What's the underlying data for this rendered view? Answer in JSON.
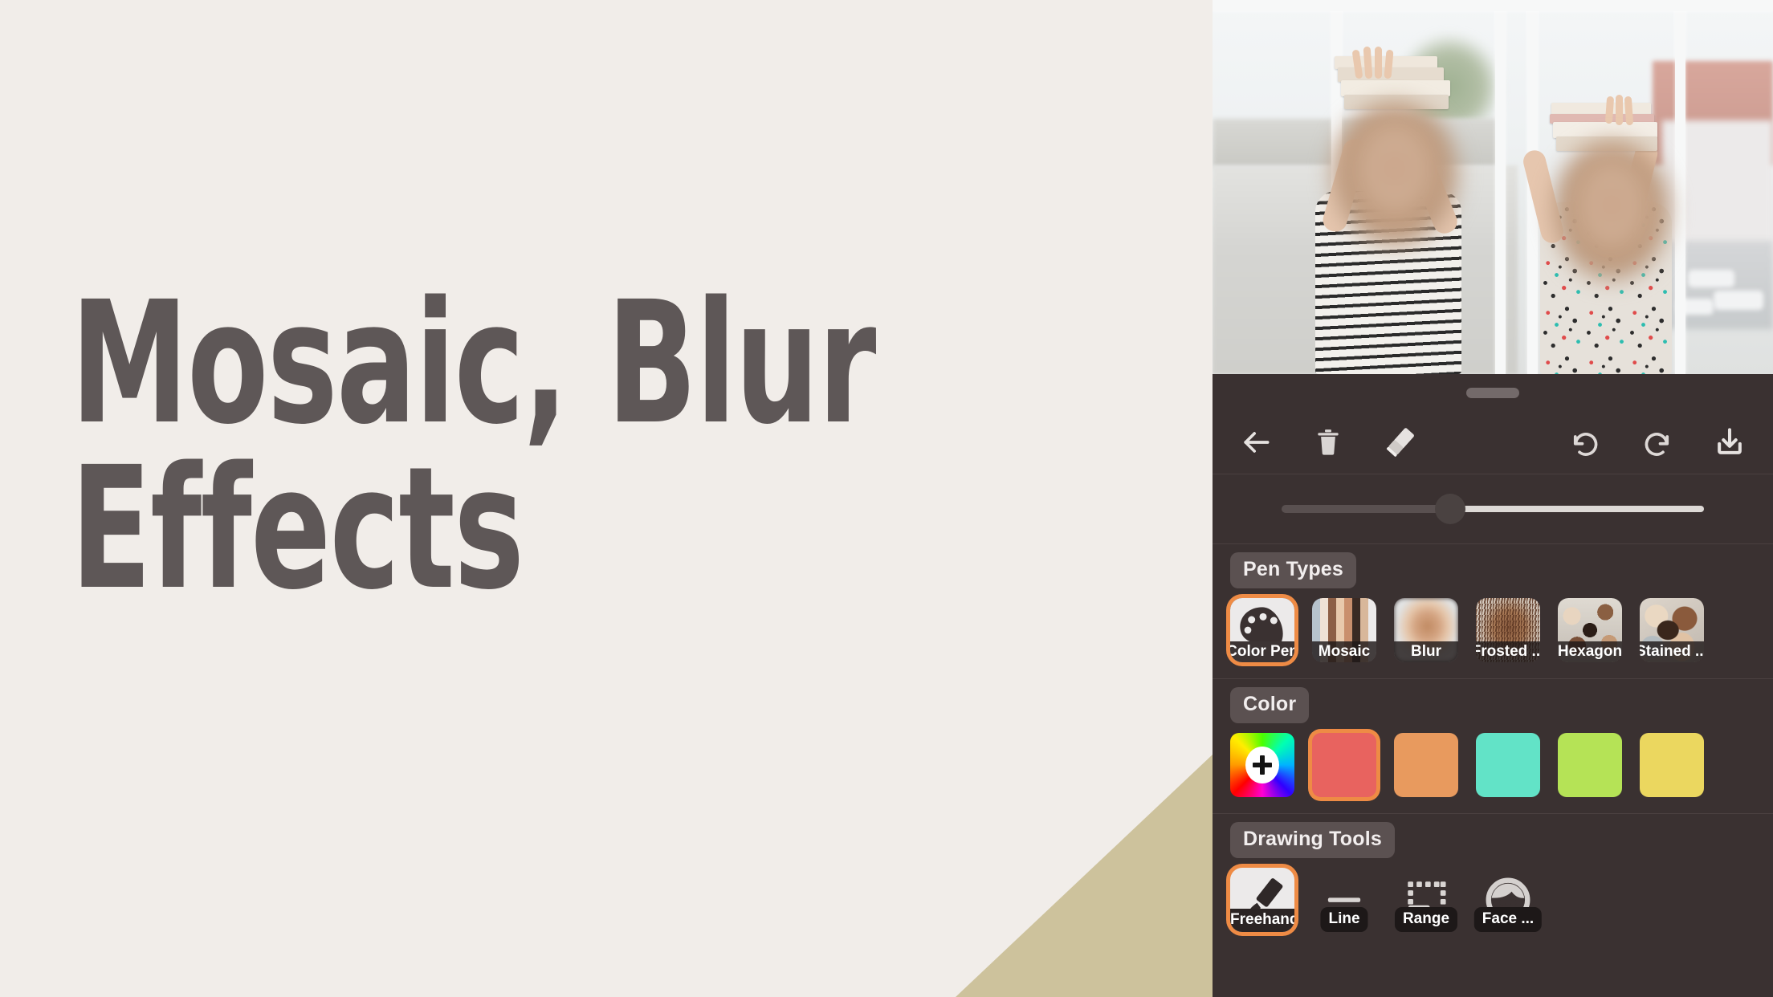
{
  "colors": {
    "page_bg": "#F1EDE9",
    "title_text": "#5E5757",
    "corner_accent": "#CDC29C",
    "panel_bg": "#3A3131",
    "selection_accent": "#EE8B45",
    "label_pill_bg": "#5B5151"
  },
  "title": {
    "line1": "Mosaic, Blur",
    "line2": "Effects"
  },
  "photo": {
    "description": "two-children-holding-books-blurred-faces"
  },
  "toolbar": {
    "back_label": "back-arrow",
    "delete_label": "trash",
    "eraser_label": "eraser",
    "undo_label": "undo",
    "redo_label": "redo",
    "save_label": "download"
  },
  "slider": {
    "name": "brush-size-slider",
    "value_percent": 40
  },
  "sections": {
    "pen_types": {
      "label": "Pen Types",
      "items": [
        {
          "label": "Color Pen",
          "selected": true,
          "thumb": "thumb-white"
        },
        {
          "label": "Mosaic",
          "selected": false,
          "thumb": "thumb-mosaic"
        },
        {
          "label": "Blur",
          "selected": false,
          "thumb": "thumb-blur"
        },
        {
          "label": "Frosted ...",
          "selected": false,
          "thumb": "thumb-frosted"
        },
        {
          "label": "Hexagon",
          "selected": false,
          "thumb": "thumb-hexagon"
        },
        {
          "label": "Stained ...",
          "selected": false,
          "thumb": "thumb-stained"
        }
      ]
    },
    "color": {
      "label": "Color",
      "picker_name": "color-wheel-add",
      "swatches": [
        {
          "hex": "#E8635F",
          "selected": true
        },
        {
          "hex": "#E89A5E",
          "selected": false
        },
        {
          "hex": "#62E3C7",
          "selected": false
        },
        {
          "hex": "#B5E356",
          "selected": false
        },
        {
          "hex": "#EBD75F",
          "selected": false
        }
      ]
    },
    "drawing_tools": {
      "label": "Drawing Tools",
      "items": [
        {
          "label": "Freehand",
          "selected": true,
          "icon": "brush-icon"
        },
        {
          "label": "Line",
          "selected": false,
          "icon": "line-icon"
        },
        {
          "label": "Range",
          "selected": false,
          "icon": "range-select-icon"
        },
        {
          "label": "Face ...",
          "selected": false,
          "icon": "face-icon"
        }
      ]
    }
  }
}
